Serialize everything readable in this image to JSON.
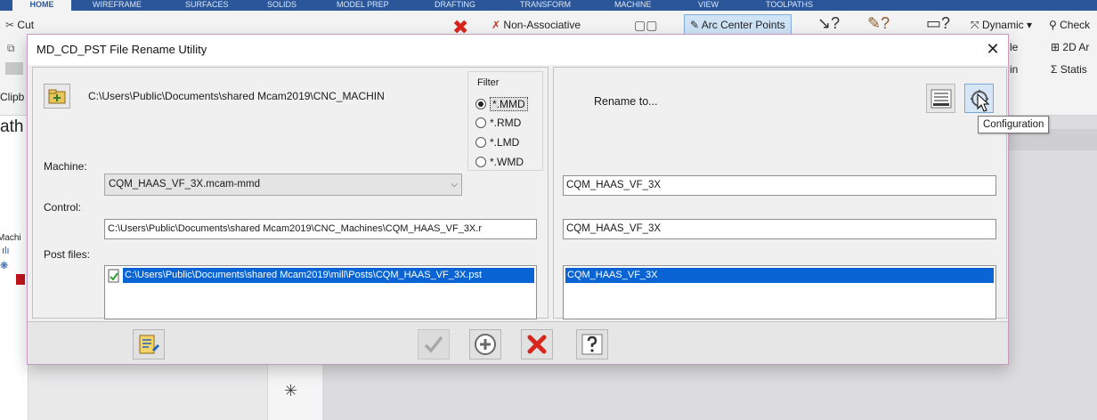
{
  "background": {
    "tabs": [
      "HOME",
      "WIREFRAME",
      "SURFACES",
      "SOLIDS",
      "MODEL PREP",
      "DRAFTING",
      "TRANSFORM",
      "MACHINE",
      "VIEW",
      "TOOLPATHS"
    ],
    "ribbon": {
      "cut": "Cut",
      "clipboard": "Clipb",
      "non_associative": "Non-Associative",
      "arc_center_points": "Arc Center Points",
      "dynamic": "Dynamic",
      "check": "Check",
      "two_d": "2D Ar",
      "ble": "le",
      "in": "in",
      "statistics": "Statis"
    },
    "left_pane": {
      "path": "ath",
      "machine": "Machi"
    }
  },
  "dialog": {
    "title": "MD_CD_PST File Rename Utility",
    "close_glyph": "✕",
    "machine_path": "C:\\Users\\Public\\Documents\\shared  Mcam2019\\CNC_MACHIN",
    "filter": {
      "legend": "Filter",
      "options": [
        {
          "label": "*.MMD",
          "selected": true
        },
        {
          "label": "*.RMD",
          "selected": false
        },
        {
          "label": "*.LMD",
          "selected": false
        },
        {
          "label": "*.WMD",
          "selected": false
        }
      ]
    },
    "labels": {
      "machine": "Machine:",
      "control": "Control:",
      "post_files": "Post files:"
    },
    "machine_value": "CQM_HAAS_VF_3X.mcam-mmd",
    "control_value": "C:\\Users\\Public\\Documents\\shared Mcam2019\\CNC_Machines\\CQM_HAAS_VF_3X.r",
    "post_file_value": "C:\\Users\\Public\\Documents\\shared Mcam2019\\mill\\Posts\\CQM_HAAS_VF_3X.pst",
    "rename": {
      "label": "Rename to...",
      "machine_value": "CQM_HAAS_VF_3X",
      "control_value": "CQM_HAAS_VF_3X",
      "post_value": "CQM_HAAS_VF_3X"
    },
    "tooltip": "Configuration"
  },
  "colors": {
    "selection": "#0a64d4",
    "delete_red": "#d7261c",
    "ribbon_blue": "#2b579a"
  },
  "icons": [
    "folder-icon",
    "list-view-icon",
    "configuration-icon",
    "edit-icon",
    "check-icon",
    "add-icon",
    "delete-icon",
    "help-icon",
    "close-icon"
  ]
}
